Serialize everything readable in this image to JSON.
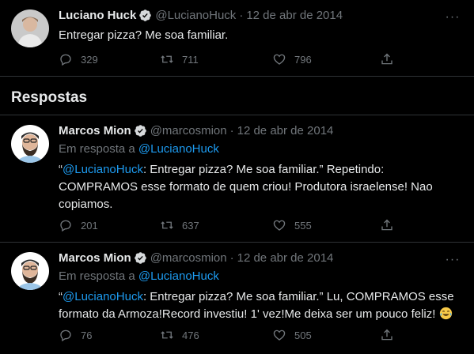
{
  "main_tweet": {
    "name": "Luciano Huck",
    "handle": "@LucianoHuck",
    "date": "12 de abr de 2014",
    "text": "Entregar pizza? Me soa familiar.",
    "replies": "329",
    "retweets": "711",
    "likes": "796"
  },
  "section_title": "Respostas",
  "replies": [
    {
      "name": "Marcos Mion",
      "handle": "@marcosmion",
      "date": "12 de abr de 2014",
      "reply_to_prefix": "Em resposta a",
      "reply_to_handle": "@LucianoHuck",
      "quote_open": "“",
      "mention": "@LucianoHuck",
      "text_rest": ": Entregar pizza? Me soa familiar.” Repetindo: COMPRAMOS esse formato de quem criou! Produtora israelense! Nao copiamos.",
      "replies": "201",
      "retweets": "637",
      "likes": "555"
    },
    {
      "name": "Marcos Mion",
      "handle": "@marcosmion",
      "date": "12 de abr de 2014",
      "reply_to_prefix": "Em resposta a",
      "reply_to_handle": "@LucianoHuck",
      "quote_open": "“",
      "mention": "@LucianoHuck",
      "text_rest": ": Entregar pizza? Me soa familiar.” Lu, COMPRAMOS esse formato da Armoza!Record investiu! 1' vez!Me deixa ser um pouco feliz! ",
      "emoji": "laughing-tears-emoji",
      "replies": "76",
      "retweets": "476",
      "likes": "505"
    }
  ],
  "colors": {
    "background": "#000000",
    "text": "#e7e9ea",
    "muted": "#71767b",
    "link": "#1d9bf0",
    "divider": "#2f3336"
  }
}
